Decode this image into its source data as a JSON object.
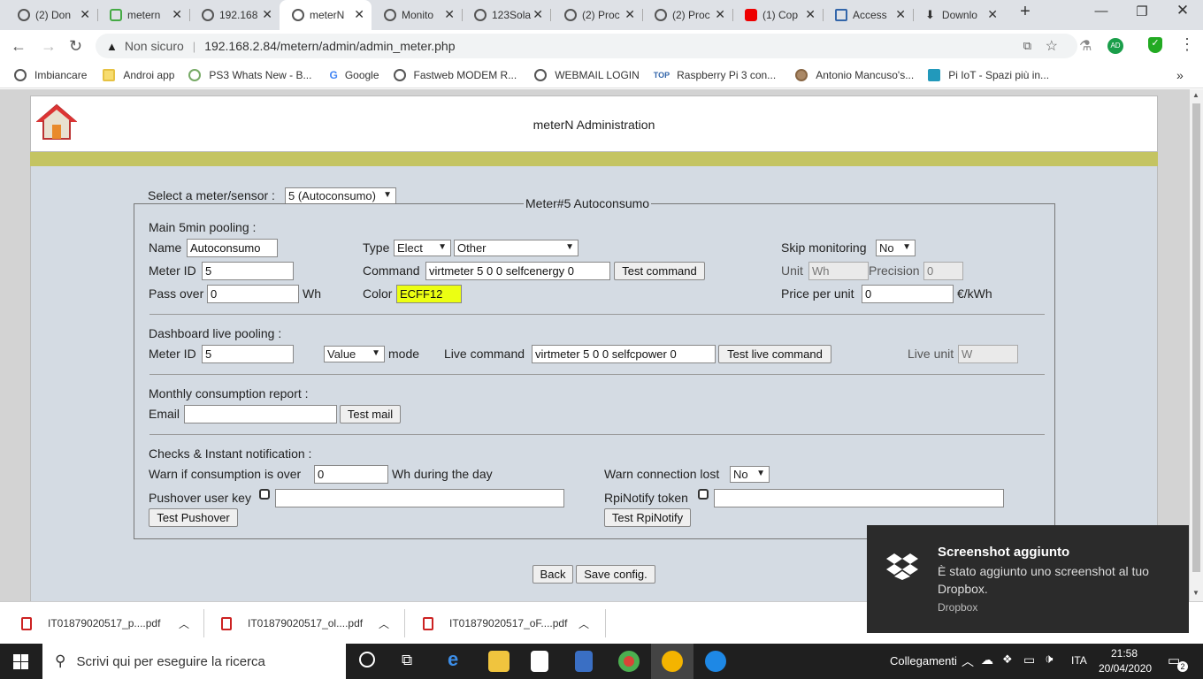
{
  "tabs": [
    {
      "label": "(2) Don",
      "icon": "globe-icon"
    },
    {
      "label": "metern",
      "icon": "metern-icon"
    },
    {
      "label": "192.168",
      "icon": "globe-icon"
    },
    {
      "label": "meterN",
      "icon": "globe-icon",
      "active": true
    },
    {
      "label": "Monito",
      "icon": "globe-icon"
    },
    {
      "label": "123Sola",
      "icon": "globe-icon"
    },
    {
      "label": "(2) Proc",
      "icon": "globe-icon"
    },
    {
      "label": "(2) Proc",
      "icon": "globe-icon"
    },
    {
      "label": "(1) Cop",
      "icon": "youtube-icon"
    },
    {
      "label": "Access",
      "icon": "access-icon"
    },
    {
      "label": "Downlo",
      "icon": "download-icon"
    }
  ],
  "browser": {
    "security_label": "Non sicuro",
    "url": "192.168.2.84/metern/admin/admin_meter.php",
    "profile_initials": "AD"
  },
  "bookmarks": [
    "Imbiancare",
    "Androi app",
    "PS3 Whats New - B...",
    "Google",
    "Fastweb MODEM R...",
    "WEBMAIL LOGIN",
    "Raspberry Pi 3 con...",
    "Antonio Mancuso's...",
    "Pi IoT - Spazi più in..."
  ],
  "header": {
    "title": "meterN Administration"
  },
  "selector": {
    "label": "Select a meter/sensor :",
    "value": "5 (Autoconsumo)"
  },
  "fieldset_legend": "Meter#5 Autoconsumo",
  "main_pooling": {
    "heading": "Main 5min pooling :",
    "name_label": "Name",
    "name_value": "Autoconsumo",
    "type_label": "Type",
    "type_value": "Elect",
    "subtype_value": "Other",
    "skip_label": "Skip monitoring",
    "skip_value": "No",
    "meterid_label": "Meter ID",
    "meterid_value": "5",
    "command_label": "Command",
    "command_value": "virtmeter 5 0 0 selfcenergy 0",
    "test_command_label": "Test command",
    "unit_label": "Unit",
    "unit_value": "Wh",
    "precision_label": "Precision",
    "precision_value": "0",
    "passover_label": "Pass over",
    "passover_value": "0",
    "passover_unit": "Wh",
    "color_label": "Color",
    "color_value": "ECFF12",
    "price_label": "Price per unit",
    "price_value": "0",
    "price_unit": "€/kWh"
  },
  "live_pooling": {
    "heading": "Dashboard live pooling :",
    "meterid_label": "Meter ID",
    "meterid_value": "5",
    "mode_value": "Value",
    "mode_label": "mode",
    "command_label": "Live command",
    "command_value": "virtmeter 5 0 0 selfcpower 0",
    "test_label": "Test live command",
    "unit_label": "Live unit",
    "unit_value": "W"
  },
  "monthly": {
    "heading": "Monthly consumption report :",
    "email_label": "Email",
    "email_value": "",
    "test_label": "Test mail"
  },
  "notify": {
    "heading": "Checks & Instant notification :",
    "warn_label": "Warn if consumption is over",
    "warn_value": "0",
    "warn_suffix": "Wh during the day",
    "lost_label": "Warn connection lost",
    "lost_value": "No",
    "pushover_label": "Pushover user key",
    "pushover_value": "",
    "rpinotify_label": "RpiNotify token",
    "rpinotify_value": "",
    "test_pushover_label": "Test Pushover",
    "test_rpinotify_label": "Test RpiNotify"
  },
  "footer_buttons": {
    "back": "Back",
    "save": "Save config."
  },
  "downloads": [
    "IT01879020517_p....pdf",
    "IT01879020517_ol....pdf",
    "IT01879020517_oF....pdf"
  ],
  "taskbar": {
    "search_placeholder": "Scrivi qui per eseguire la ricerca",
    "links_label": "Collegamenti",
    "lang": "ITA",
    "time": "21:58",
    "date": "20/04/2020",
    "notif_count": "2"
  },
  "toast": {
    "title": "Screenshot aggiunto",
    "body": "È stato aggiunto uno screenshot al tuo Dropbox.",
    "source": "Dropbox"
  },
  "colors": {
    "meter_color": "#ECFF12",
    "olive": "#c4c462",
    "panel": "#d4dbe3"
  }
}
